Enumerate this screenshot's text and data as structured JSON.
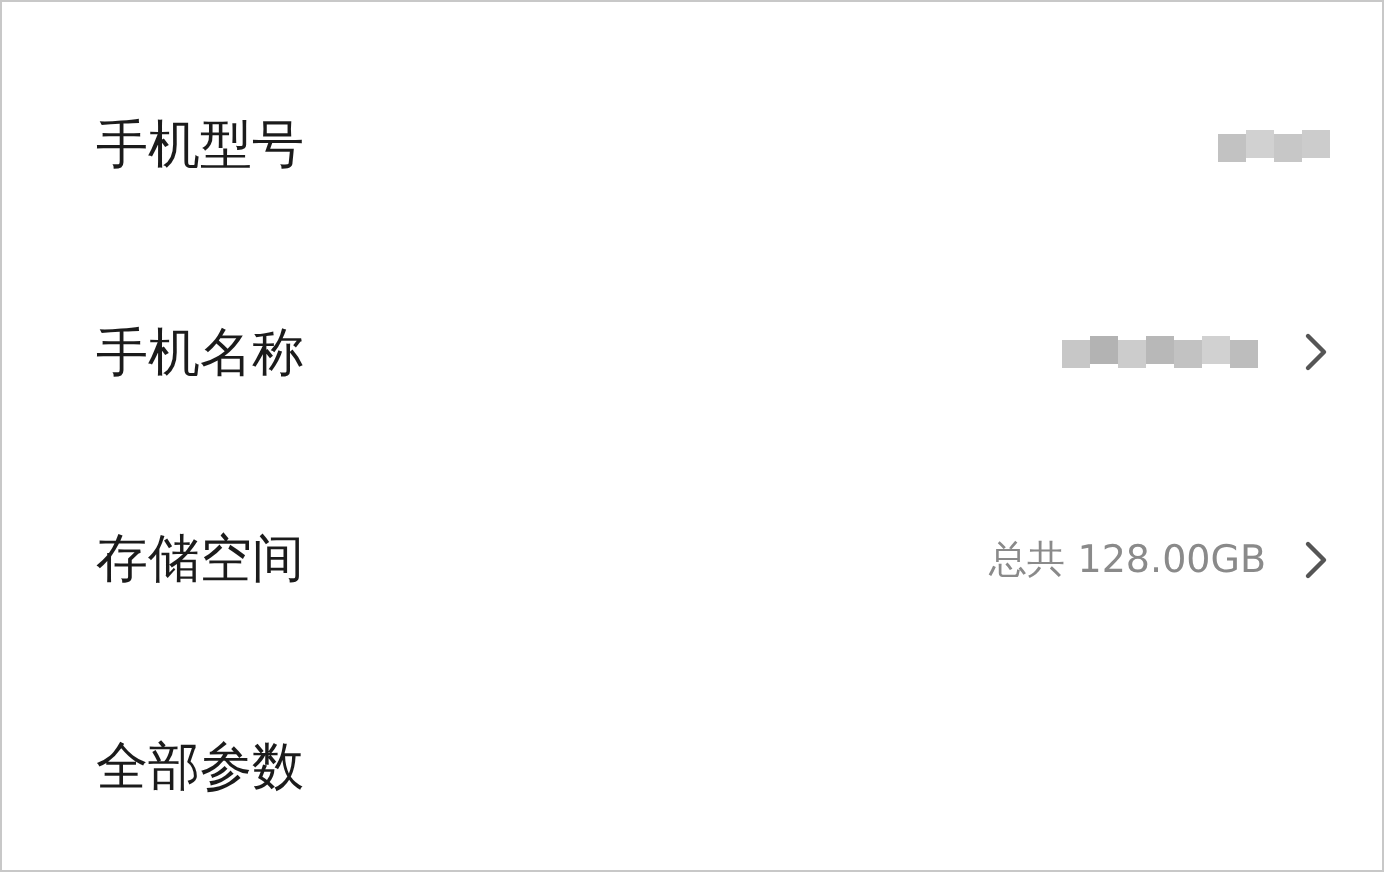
{
  "rows": [
    {
      "label": "手机型号",
      "value_hidden": true,
      "chevron": false
    },
    {
      "label": "手机名称",
      "value_hidden": true,
      "chevron": true
    },
    {
      "label": "存储空间",
      "value": "总共 128.00GB",
      "value_hidden": false,
      "chevron": true
    },
    {
      "label": "全部参数",
      "value_hidden": false,
      "chevron": false
    }
  ]
}
